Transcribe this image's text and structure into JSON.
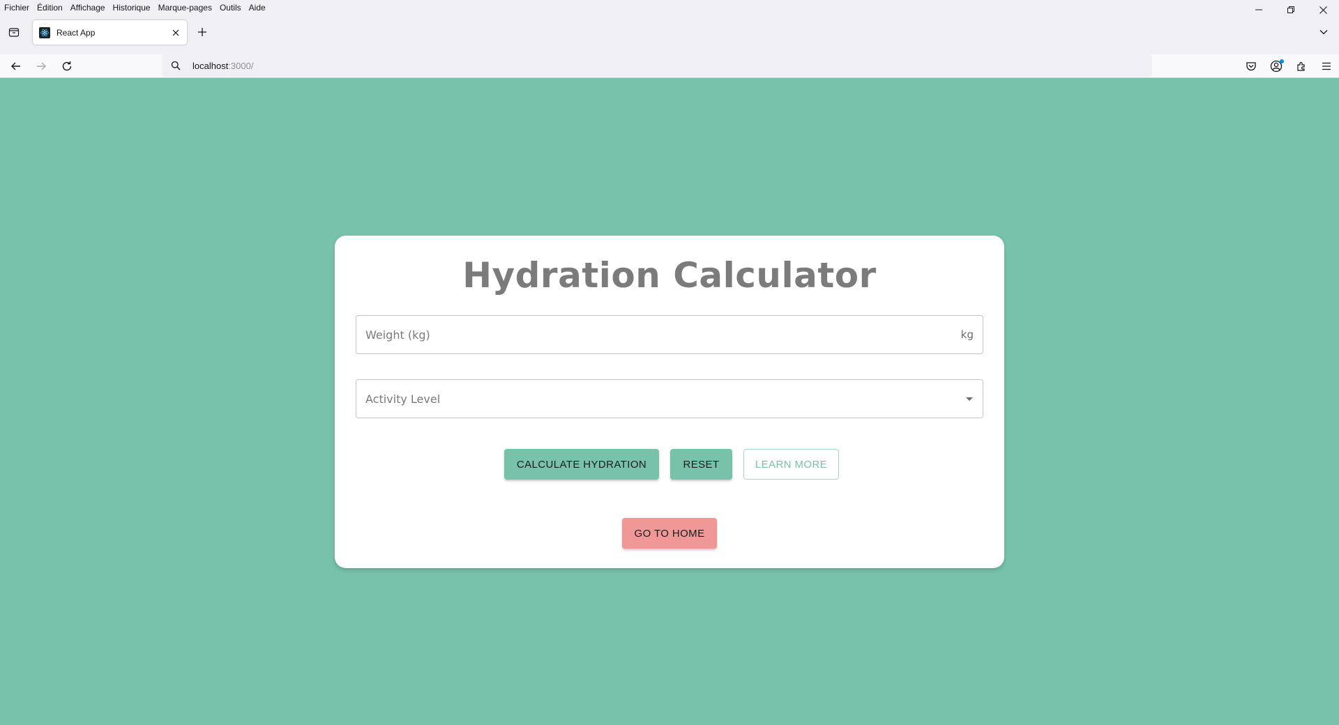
{
  "browser": {
    "menu": [
      "Fichier",
      "Édition",
      "Affichage",
      "Historique",
      "Marque-pages",
      "Outils",
      "Aide"
    ],
    "tab": {
      "title": "React App"
    },
    "url": {
      "host": "localhost",
      "port": ":3000/"
    }
  },
  "app": {
    "title": "Hydration Calculator",
    "weight_field": {
      "placeholder": "Weight (kg)",
      "suffix": "kg"
    },
    "activity_field": {
      "placeholder": "Activity Level"
    },
    "buttons": {
      "calculate": "CALCULATE HYDRATION",
      "reset": "RESET",
      "learn_more": "LEARN MORE",
      "home": "GO TO HOME"
    }
  },
  "colors": {
    "background": "#78c1ab",
    "primary": "#78c1ab",
    "home_button": "#f09898",
    "card": "#ffffff"
  }
}
